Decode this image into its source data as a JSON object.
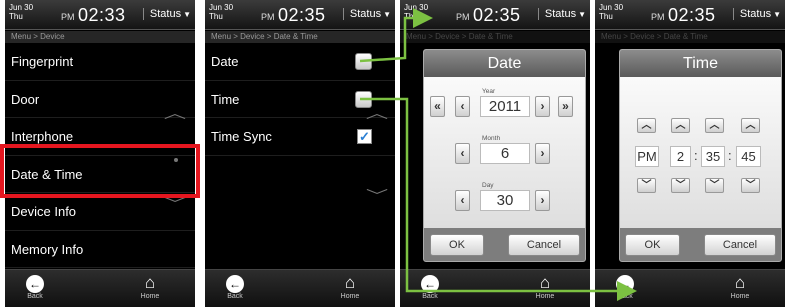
{
  "statusbar": {
    "date_line1": "Jun  30",
    "date_line2": "Thu",
    "ampm": "PM",
    "time_screen1": "02:33",
    "time_screen2": "02:35",
    "status_label": "Status"
  },
  "screen1": {
    "breadcrumb": "Menu > Device",
    "items": [
      "Fingerprint",
      "Door",
      "Interphone",
      "Date & Time",
      "Device Info",
      "Memory Info"
    ]
  },
  "screen2": {
    "breadcrumb": "Menu > Device > Date & Time",
    "items": [
      "Date",
      "Time",
      "Time Sync"
    ]
  },
  "date_dialog": {
    "title": "Date",
    "year_label": "Year",
    "year": "2011",
    "month_label": "Month",
    "month": "6",
    "day_label": "Day",
    "day": "30",
    "ok": "OK",
    "cancel": "Cancel"
  },
  "time_dialog": {
    "title": "Time",
    "ampm": "PM",
    "hour": "2",
    "minute": "35",
    "second": "45",
    "ok": "OK",
    "cancel": "Cancel"
  },
  "bottombar": {
    "back": "Back",
    "home": "Home"
  },
  "colors": {
    "highlight": "#e5161f",
    "connector": "#7cc142"
  }
}
